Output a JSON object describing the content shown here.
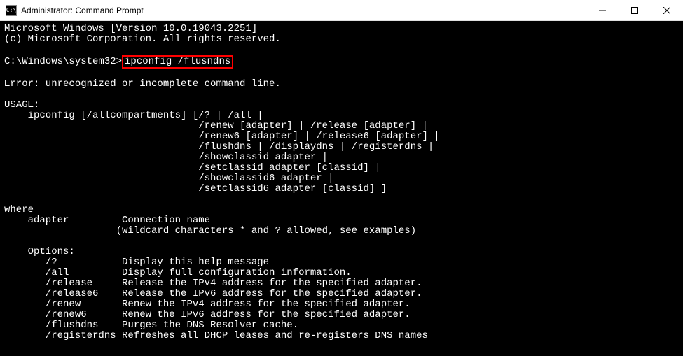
{
  "window": {
    "title": "Administrator: Command Prompt",
    "icon_label": "C:\\"
  },
  "terminal": {
    "line1": "Microsoft Windows [Version 10.0.19043.2251]",
    "line2": "(c) Microsoft Corporation. All rights reserved.",
    "blank1": "",
    "prompt_prefix": "C:\\Windows\\system32>",
    "command_highlight": "ipconfig /flusndns",
    "blank2": "",
    "error": "Error: unrecognized or incomplete command line.",
    "blank3": "",
    "usage_header": "USAGE:",
    "usage1": "    ipconfig [/allcompartments] [/? | /all |",
    "usage2": "                                 /renew [adapter] | /release [adapter] |",
    "usage3": "                                 /renew6 [adapter] | /release6 [adapter] |",
    "usage4": "                                 /flushdns | /displaydns | /registerdns |",
    "usage5": "                                 /showclassid adapter |",
    "usage6": "                                 /setclassid adapter [classid] |",
    "usage7": "                                 /showclassid6 adapter |",
    "usage8": "                                 /setclassid6 adapter [classid] ]",
    "blank4": "",
    "where_header": "where",
    "where1": "    adapter         Connection name",
    "where2": "                   (wildcard characters * and ? allowed, see examples)",
    "blank5": "",
    "options_header": "    Options:",
    "opt1": "       /?           Display this help message",
    "opt2": "       /all         Display full configuration information.",
    "opt3": "       /release     Release the IPv4 address for the specified adapter.",
    "opt4": "       /release6    Release the IPv6 address for the specified adapter.",
    "opt5": "       /renew       Renew the IPv4 address for the specified adapter.",
    "opt6": "       /renew6      Renew the IPv6 address for the specified adapter.",
    "opt7": "       /flushdns    Purges the DNS Resolver cache.",
    "opt8": "       /registerdns Refreshes all DHCP leases and re-registers DNS names"
  }
}
